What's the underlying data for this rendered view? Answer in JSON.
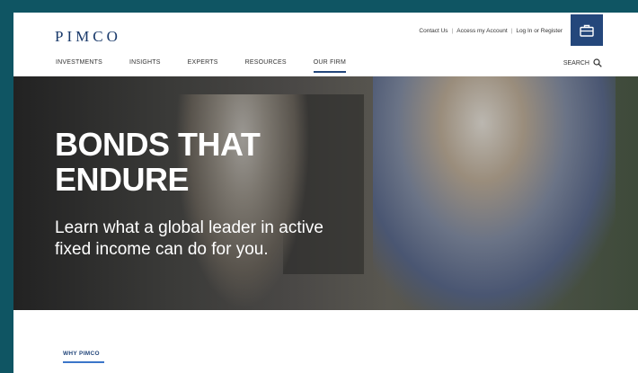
{
  "header": {
    "logo": "PIMCO",
    "utility_links": [
      "Contact Us",
      "Access my Account",
      "Log In or Register"
    ],
    "bag_icon": "briefcase-icon",
    "accent": "#24477b"
  },
  "nav": {
    "items": [
      "INVESTMENTS",
      "INSIGHTS",
      "EXPERTS",
      "RESOURCES",
      "OUR FIRM"
    ],
    "active": "OUR FIRM",
    "search_label": "SEARCH",
    "search_icon": "search-icon"
  },
  "hero": {
    "title_line1": "BONDS THAT",
    "title_line2": "ENDURE",
    "subtitle_line1": "Learn what a global leader in active",
    "subtitle_line2": "fixed income can do for you."
  },
  "section": {
    "label": "WHY PIMCO"
  }
}
